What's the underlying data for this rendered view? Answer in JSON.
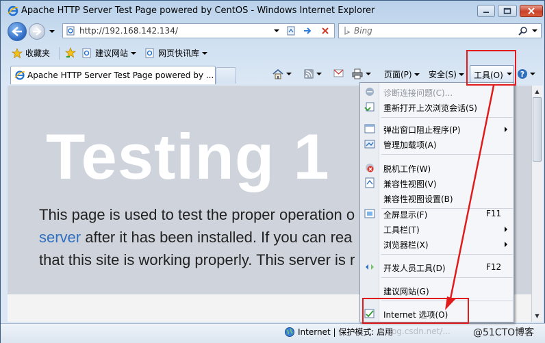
{
  "window": {
    "title": "Apache HTTP Server Test Page powered by CentOS - Windows Internet Explorer"
  },
  "address_bar": {
    "url": "http://192.168.142.134/",
    "search_placeholder": "Bing"
  },
  "favorites_bar": {
    "favorites_label": "收藏夹",
    "suggested_sites": "建议网站",
    "web_slice_gallery": "网页快讯库"
  },
  "tabs": [
    {
      "label": "Apache HTTP Server Test Page powered by ..."
    }
  ],
  "command_bar": {
    "page": "页面(P)",
    "safety": "安全(S)",
    "tools": "工具(O)"
  },
  "content": {
    "heading": "Testing 1",
    "line1": "This page is used to test the proper operation o",
    "line2_link": "server",
    "line2_rest": " after it has been installed. If you can rea",
    "line3": "that this site is working properly. This server is r"
  },
  "tools_menu": {
    "items": [
      {
        "label": "诊断连接问题(C)...",
        "icon": "diagnose-icon",
        "disabled": true
      },
      {
        "label": "重新打开上次浏览会话(S)",
        "icon": "reopen-session-icon"
      },
      {
        "label": "弹出窗口阻止程序(P)",
        "icon": "popup-blocker-icon",
        "submenu": true
      },
      {
        "label": "管理加载项(A)",
        "icon": "addons-icon"
      },
      {
        "label": "脱机工作(W)",
        "icon": "offline-icon"
      },
      {
        "label": "兼容性视图(V)",
        "icon": "compat-view-icon"
      },
      {
        "label": "兼容性视图设置(B)",
        "icon": ""
      },
      {
        "label": "全屏显示(F)",
        "icon": "fullscreen-icon",
        "accel": "F11"
      },
      {
        "label": "工具栏(T)",
        "icon": "",
        "submenu": true
      },
      {
        "label": "浏览器栏(X)",
        "icon": "",
        "submenu": true
      },
      {
        "label": "开发人员工具(D)",
        "icon": "developer-tools-icon",
        "accel": "F12"
      },
      {
        "label": "建议网站(G)",
        "icon": ""
      },
      {
        "label": "Internet 选项(O)",
        "icon": "internet-options-icon"
      }
    ]
  },
  "status_bar": {
    "zone": "Internet | 保护模式: 启用",
    "watermark": "blog.csdn.net/...",
    "brand": "@51CTO博客"
  },
  "colors": {
    "annotation_red": "#e11b1b",
    "link_blue": "#2f6fbe"
  }
}
